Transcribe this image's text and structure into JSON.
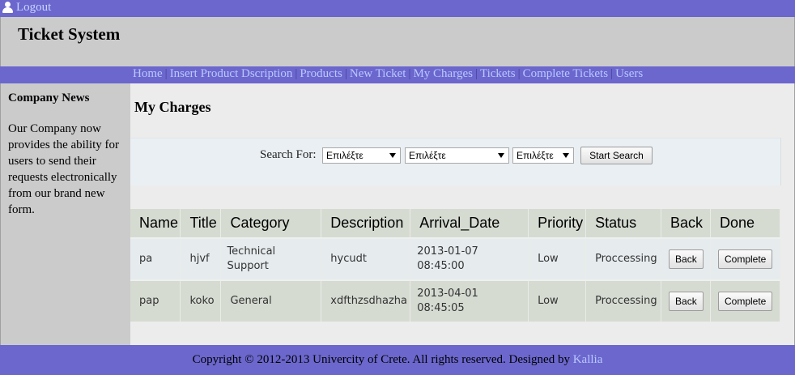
{
  "topbar": {
    "logout_label": "Logout",
    "icon": "user-icon"
  },
  "header": {
    "title": "Ticket System"
  },
  "nav": {
    "items": [
      "Home",
      "Insert Product Dscription",
      "Products",
      "New Ticket",
      "My Charges",
      "Tickets",
      "Complete Tickets",
      "Users"
    ]
  },
  "sidebar": {
    "title": "Company News",
    "text": "Our Company now provides the ability for users to send their requests electronically from our brand new form."
  },
  "main": {
    "page_title": "My Charges",
    "search": {
      "label": "Search For:",
      "select1": "Επιλέξτε",
      "select2": "Επιλέξτε",
      "select3": "Επιλέξτε",
      "button": "Start Search"
    },
    "table": {
      "headers": [
        "Name",
        "Title",
        "Category",
        "Description",
        "Arrival_Date",
        "Priority",
        "Status",
        "Back",
        "Done"
      ],
      "rows": [
        {
          "name": "pa",
          "title": "hjvf",
          "category": "Technical Support",
          "description": "hycudt",
          "arrival_date": "2013-01-07 08:45:00",
          "priority": "Low",
          "status": "Proccessing",
          "back": "Back",
          "done": "Complete"
        },
        {
          "name": "pap",
          "title": "koko",
          "category": "General",
          "description": "xdfthzsdhazha",
          "arrival_date": "2013-04-01 08:45:05",
          "priority": "Low",
          "status": "Proccessing",
          "back": "Back",
          "done": "Complete"
        }
      ]
    }
  },
  "footer": {
    "text": "Copyright © 2012-2013 Univercity of Crete. All rights reserved. Designed by",
    "link": "Kallia"
  },
  "colors": {
    "bar": "#6b67cd",
    "link": "#b9c8ff",
    "panel": "#cbcbcb",
    "content": "#ececec"
  }
}
